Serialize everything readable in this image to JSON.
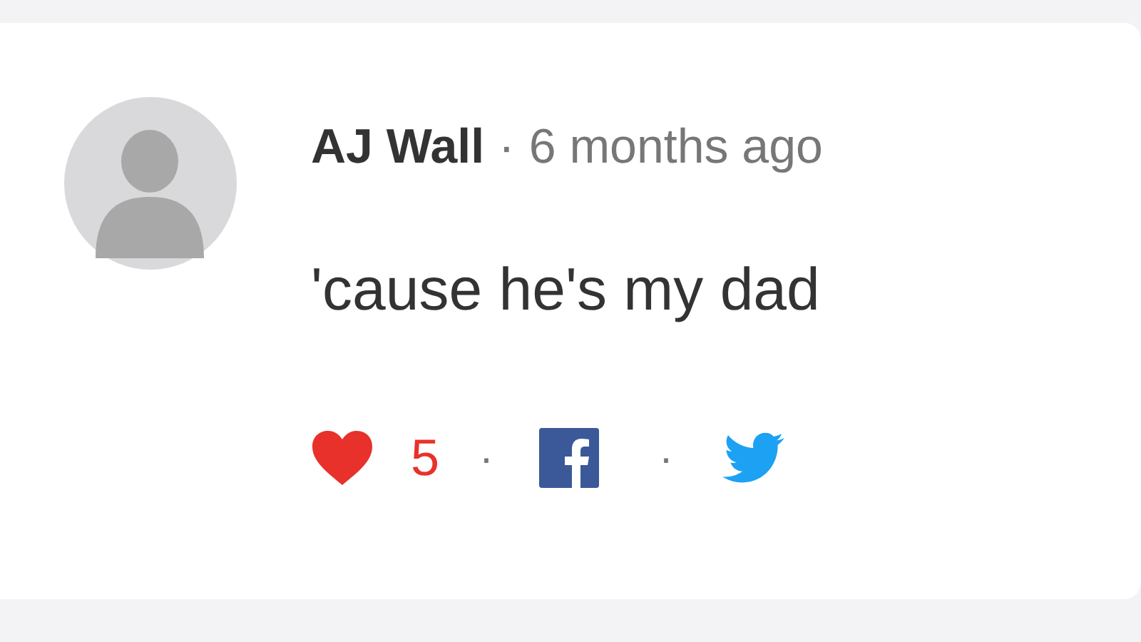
{
  "comment": {
    "author": "AJ Wall",
    "separator": "·",
    "time": "6 months ago",
    "text": "'cause he's my dad",
    "likes": {
      "count": "5",
      "liked": true
    },
    "action_separators": [
      "·",
      "·"
    ]
  }
}
